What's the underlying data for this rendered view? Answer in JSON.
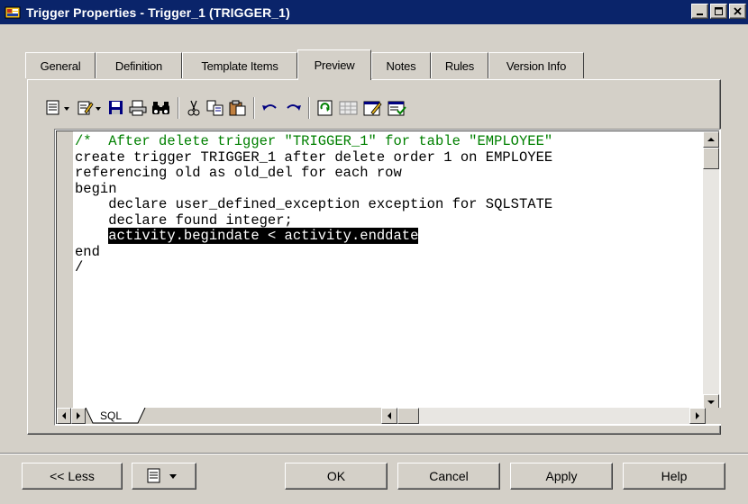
{
  "window": {
    "title": "Trigger Properties - Trigger_1 (TRIGGER_1)",
    "icon": "trigger-app-icon"
  },
  "tabs": [
    {
      "label": "General",
      "active": false
    },
    {
      "label": "Definition",
      "active": false
    },
    {
      "label": "Template Items",
      "active": false
    },
    {
      "label": "Preview",
      "active": true
    },
    {
      "label": "Notes",
      "active": false
    },
    {
      "label": "Rules",
      "active": false
    },
    {
      "label": "Version Info",
      "active": false
    }
  ],
  "toolbar": [
    "properties-menu-icon",
    "edit-menu-icon",
    "save-icon",
    "print-icon",
    "find-icon",
    "cut-icon",
    "copy-icon",
    "paste-icon",
    "undo-icon",
    "redo-icon",
    "refresh-icon",
    "grid-icon",
    "check-icon",
    "generate-icon"
  ],
  "editor": {
    "lines": [
      {
        "text": "/*  After delete trigger \"TRIGGER_1\" for table \"EMPLOYEE\"",
        "style": "comment"
      },
      {
        "text": "create trigger TRIGGER_1 after delete order 1 on EMPLOYEE",
        "style": "normal"
      },
      {
        "text": "referencing old as old_del for each row",
        "style": "normal"
      },
      {
        "text": "begin",
        "style": "normal"
      },
      {
        "text": "    declare user_defined_exception exception for SQLSTATE",
        "style": "normal"
      },
      {
        "text": "    declare found integer;",
        "style": "normal"
      },
      {
        "text": "    activity.begindate < activity.enddate",
        "style": "selected"
      },
      {
        "text": "end",
        "style": "normal"
      },
      {
        "text": "/",
        "style": "normal"
      }
    ],
    "sheet_tab": "SQL"
  },
  "buttons": {
    "less": "<< Less",
    "ok": "OK",
    "cancel": "Cancel",
    "apply": "Apply",
    "help": "Help"
  }
}
